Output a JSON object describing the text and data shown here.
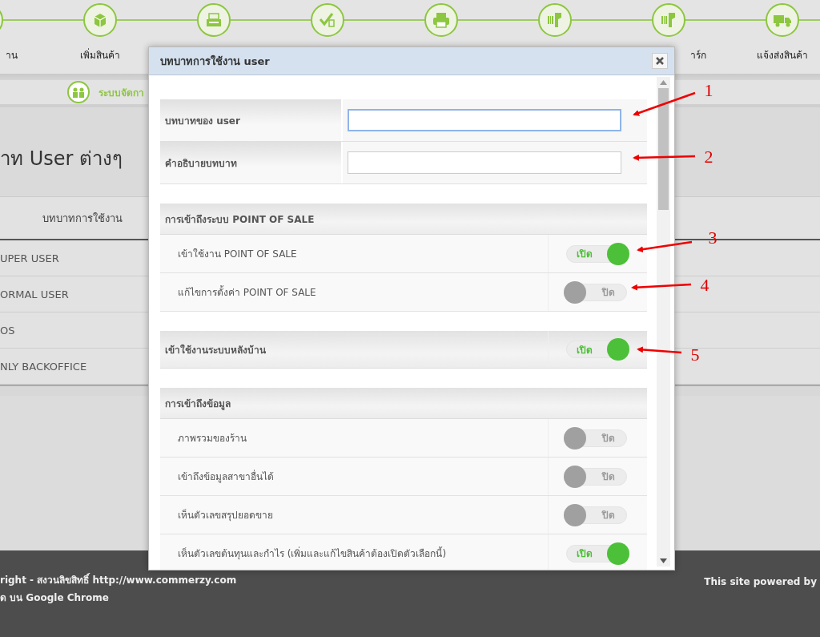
{
  "nav": {
    "labels_left": [
      "าน",
      "เพิ่มสินค้า"
    ],
    "labels_right": [
      "าร์ก",
      "แจ้งส่งสินค้า"
    ]
  },
  "breadcrumb": "ระบบจัดกา",
  "page_title": "าท User ต่างๆ",
  "table": {
    "columns": [
      "บทบาทการใช้งาน"
    ],
    "rows": [
      "UPER USER",
      "ORMAL USER",
      "OS",
      "NLY BACKOFFICE"
    ]
  },
  "dialog": {
    "title": "บทบาทการใช้งาน user",
    "fields": [
      {
        "label": "บทบาทของ user",
        "focused": true
      },
      {
        "label": "คำอธิบายบทบาท",
        "focused": false
      }
    ],
    "sections": [
      {
        "title": "การเข้าถึงระบบ POINT OF SALE",
        "items": [
          {
            "label": "เข้าใช้งาน POINT OF SALE",
            "on": true,
            "toggle_label": "เปิด"
          },
          {
            "label": "แก้ไขการตั้งค่า POINT OF SALE",
            "on": false,
            "toggle_label": "ปิด"
          }
        ]
      },
      {
        "title": "เข้าใช้งานระบบหลังบ้าน",
        "toggle": {
          "on": true,
          "toggle_label": "เปิด"
        }
      },
      {
        "title": "การเข้าถึงข้อมูล",
        "items": [
          {
            "label": "ภาพรวมของร้าน",
            "on": false,
            "toggle_label": "ปิด"
          },
          {
            "label": "เข้าถึงข้อมูลสาขาอื่นได้",
            "on": false,
            "toggle_label": "ปิด"
          },
          {
            "label": "เห็นตัวเลขสรุปยอดขาย",
            "on": false,
            "toggle_label": "ปิด"
          },
          {
            "label": "เห็นตัวเลขต้นทุนและกำไร (เพิ่มและแก้ไขสินค้าต้องเปิดตัวเลือกนี้)",
            "on": true,
            "toggle_label": "เปิด"
          }
        ]
      }
    ]
  },
  "annotations": [
    "1",
    "2",
    "3",
    "4",
    "5"
  ],
  "footer": {
    "lines": [
      "right - สงวนลิขสิทธิ์ http://www.commerzy.com",
      "ด บน Google Chrome"
    ],
    "right": "This site powered by"
  }
}
